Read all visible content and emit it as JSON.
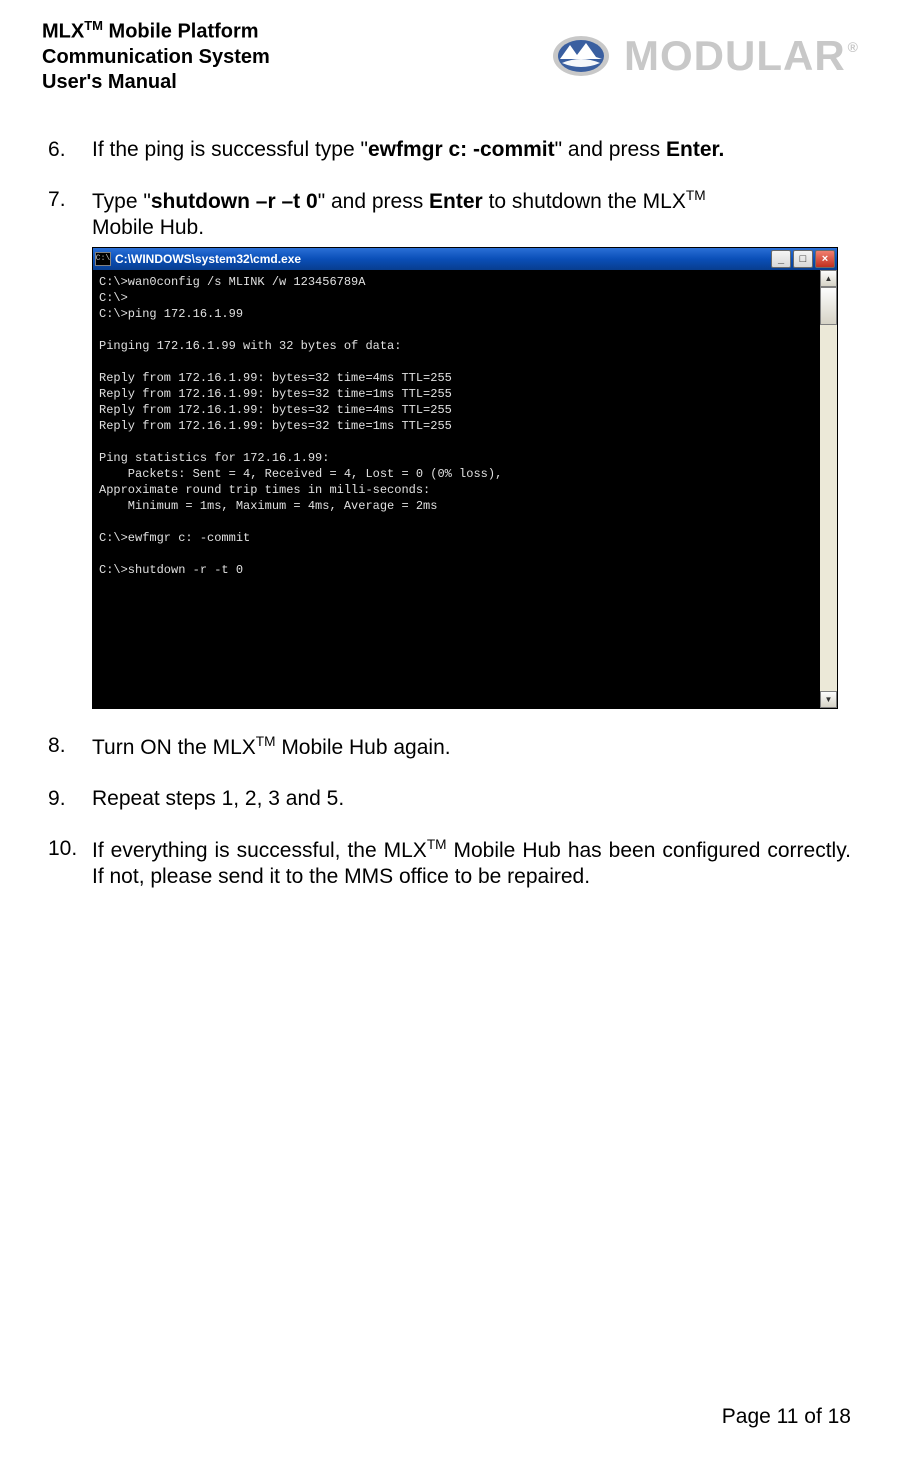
{
  "header": {
    "title_line1_prefix": "MLX",
    "title_line1_sup": "TM",
    "title_line1_suffix": " Mobile Platform",
    "title_line2": "Communication System",
    "title_line3": "User's Manual",
    "logo_word": "MODULAR",
    "logo_reg": "®"
  },
  "steps": {
    "s6_pre": "If the ping is successful type \"",
    "s6_cmd": "ewfmgr  c:  -commit",
    "s6_mid": "\" and press ",
    "s6_end": "Enter.",
    "s7_pre": "Type \"",
    "s7_cmd": "shutdown  –r  –t  0",
    "s7_mid": "\" and press ",
    "s7_enter": "Enter",
    "s7_after": " to shutdown the MLX",
    "s7_sup": "TM",
    "s7_line2": "Mobile Hub.",
    "s8_pre": "Turn ON the MLX",
    "s8_sup": "TM",
    "s8_post": " Mobile Hub again.",
    "s9": "Repeat steps 1, 2, 3 and 5.",
    "s10_pre": "If everything is successful, the MLX",
    "s10_sup": "TM",
    "s10_post": " Mobile Hub has been configured correctly. If not, please send it to the MMS office to be repaired."
  },
  "cmd": {
    "title_icon_glyph": "C:\\",
    "title": "C:\\WINDOWS\\system32\\cmd.exe",
    "min": "_",
    "max": "□",
    "close": "×",
    "scroll_up": "▲",
    "scroll_down": "▼",
    "body": "C:\\>wan0config /s MLINK /w 123456789A\nC:\\>\nC:\\>ping 172.16.1.99\n\nPinging 172.16.1.99 with 32 bytes of data:\n\nReply from 172.16.1.99: bytes=32 time=4ms TTL=255\nReply from 172.16.1.99: bytes=32 time=1ms TTL=255\nReply from 172.16.1.99: bytes=32 time=4ms TTL=255\nReply from 172.16.1.99: bytes=32 time=1ms TTL=255\n\nPing statistics for 172.16.1.99:\n    Packets: Sent = 4, Received = 4, Lost = 0 (0% loss),\nApproximate round trip times in milli-seconds:\n    Minimum = 1ms, Maximum = 4ms, Average = 2ms\n\nC:\\>ewfmgr c: -commit\n\nC:\\>shutdown -r -t 0\n\n\n\n\n\n\n\n"
  },
  "footer": {
    "text": "Page 11 of 18"
  }
}
